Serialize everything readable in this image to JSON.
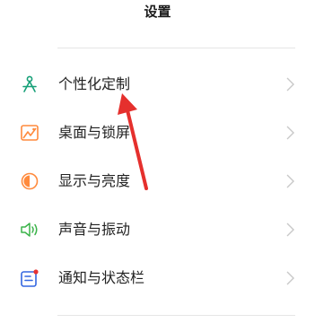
{
  "header": {
    "title": "设置"
  },
  "settings": {
    "items": [
      {
        "label": "个性化定制",
        "icon": "personalization-icon"
      },
      {
        "label": "桌面与锁屏",
        "icon": "wallpaper-icon"
      },
      {
        "label": "显示与亮度",
        "icon": "brightness-icon"
      },
      {
        "label": "声音与振动",
        "icon": "sound-icon"
      },
      {
        "label": "通知与状态栏",
        "icon": "notification-icon"
      }
    ]
  },
  "colors": {
    "accent": "#17a078",
    "wallpaper_icon": "#ff8a3c",
    "brightness_icon": "#ff8a3c",
    "sound_icon": "#3bb34a",
    "notification_icon": "#3366e0",
    "notification_dot": "#e83333",
    "annotation_arrow": "#e5302d",
    "chevron": "#c8c8c8"
  }
}
